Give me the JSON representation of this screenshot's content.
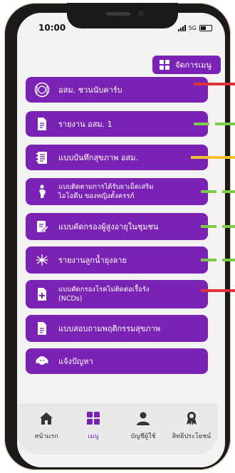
{
  "status_bar": {
    "time": "10:00",
    "network": "5G"
  },
  "header": {
    "manage_label": "จัดการเมนู",
    "manage_icon": "grid-icon"
  },
  "menu": [
    {
      "label": "อสม. ชวนนับคาร์บ",
      "icon": "carb-plate-icon",
      "marker": "red"
    },
    {
      "label": "รายงาน อสม. 1",
      "icon": "document-icon",
      "marker": "green-dashed"
    },
    {
      "label": "แบบบันทึกสุขภาพ อสม.",
      "icon": "health-record-icon",
      "marker": "yellow"
    },
    {
      "label": "แบบติดตามการได้รับยาเม็ดเสริม",
      "label_line2": "ไอโอดีน ของหญิงตั้งครรภ์",
      "icon": "pregnant-woman-icon",
      "marker": "green-dashed"
    },
    {
      "label": "แบบคัดกรองผู้สูงอายุในชุมชน",
      "icon": "form-edit-icon",
      "marker": "green-dashed"
    },
    {
      "label": "รายงานลูกน้ำยุงลาย",
      "icon": "mosquito-icon",
      "marker": "green-dashed"
    },
    {
      "label": "แบบคัดกรองโรคไม่ติดต่อเรื้อรัง",
      "label_line2": "(NCDs)",
      "icon": "medical-plus-icon",
      "marker": "red"
    },
    {
      "label": "แบบสอบถามพฤติกรรมสุขภาพ",
      "icon": "questionnaire-icon",
      "marker": "none"
    },
    {
      "label": "แจ้งปัญหา",
      "icon": "support-agent-icon",
      "marker": "none"
    }
  ],
  "tabs": [
    {
      "label": "หน้าแรก",
      "icon": "home-icon"
    },
    {
      "label": "เมนู",
      "icon": "menu-grid-icon",
      "active": true
    },
    {
      "label": "บัญชีผู้ใช้",
      "icon": "user-icon"
    },
    {
      "label": "สิทธิประโยชน์",
      "icon": "award-icon"
    }
  ],
  "colors": {
    "primary": "#7a22b3",
    "marker_red": "#e0303a",
    "marker_green": "#7ccb4a",
    "marker_yellow": "#f2c12e"
  }
}
